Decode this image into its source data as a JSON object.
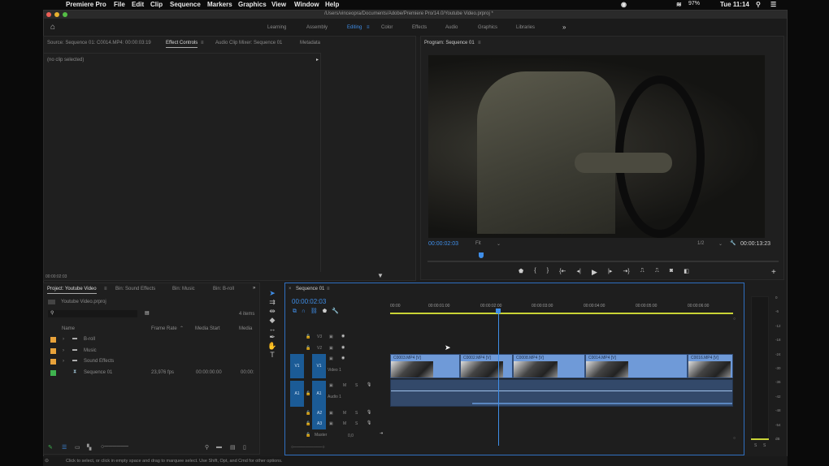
{
  "menubar": {
    "app": "Premiere Pro",
    "items": [
      "File",
      "Edit",
      "Clip",
      "Sequence",
      "Markers",
      "Graphics",
      "View",
      "Window",
      "Help"
    ],
    "battery": "97%",
    "clock": "Tue 11:14"
  },
  "window": {
    "title": "/Users/vinceopra/Documents/Adobe/Premiere Pro/14.0/Youtube Video.prproj *"
  },
  "workspaces": {
    "items": [
      "Learning",
      "Assembly",
      "Editing",
      "Color",
      "Effects",
      "Audio",
      "Graphics",
      "Libraries"
    ],
    "active": "Editing",
    "more": "»"
  },
  "source_panel": {
    "tabs": [
      "Source: Sequence 01: C0014.MP4: 00:00:03:19",
      "Effect Controls",
      "Audio Clip Mixer: Sequence 01",
      "Metadata"
    ],
    "active": "Effect Controls",
    "empty_text": "(no clip selected)",
    "timecode": "00:00:02:03"
  },
  "program": {
    "title": "Program: Sequence 01",
    "timecode": "00:00:02:03",
    "zoom": "Fit",
    "resolution": "1/2",
    "duration": "00:00:13:23",
    "progress_fraction": 0.152
  },
  "project": {
    "tabs": [
      "Project: Youtube Video",
      "Bin: Sound Effects",
      "Bin: Music",
      "Bin: B-roll"
    ],
    "more": "»",
    "file": "Youtube Video.prproj",
    "item_count": "4 items",
    "columns": [
      "Name",
      "Frame Rate",
      "Media Start",
      "Media"
    ],
    "items": [
      {
        "name": "B-roll",
        "color": "#e8a23a",
        "rate": "",
        "start": "",
        "media": ""
      },
      {
        "name": "Music",
        "color": "#e8a23a",
        "rate": "",
        "start": "",
        "media": ""
      },
      {
        "name": "Sound Effects",
        "color": "#e8a23a",
        "rate": "",
        "start": "",
        "media": ""
      },
      {
        "name": "Sequence 01",
        "color": "#3fb34f",
        "rate": "23,976 fps",
        "start": "00:00:00:00",
        "media": "00:00:"
      }
    ]
  },
  "timeline": {
    "title": "Sequence 01",
    "timecode": "00:00:02:03",
    "ruler": [
      "00:00",
      "00:00:01:00",
      "00:00:02:00",
      "00:00:03:00",
      "00:00:04:00",
      "00:00:05:00",
      "00:00:06:00"
    ],
    "tracks": {
      "v3": "V3",
      "v2": "V2",
      "v1": "V1",
      "video1": "Video 1",
      "a1": "A1",
      "audio1": "Audio 1",
      "a2": "A2",
      "a3": "A3",
      "master": "Master",
      "master_val": "0,0",
      "m": "M",
      "s": "S"
    },
    "clips": [
      "C0003.MP4 [V]",
      "C0002.MP4 [V]",
      "C0008.MP4 [V]",
      "C0014.MP4 [V]",
      "C0016.MP4 [V]"
    ]
  },
  "meters": {
    "scale": [
      "0",
      "-6",
      "-12",
      "-18",
      "-24",
      "-30",
      "-36",
      "-42",
      "-48",
      "-54",
      "dB"
    ],
    "solo": [
      "S",
      "S"
    ]
  },
  "status": "Click to select, or click in empty space and drag to marquee select. Use Shift, Opt, and Cmd for other options."
}
